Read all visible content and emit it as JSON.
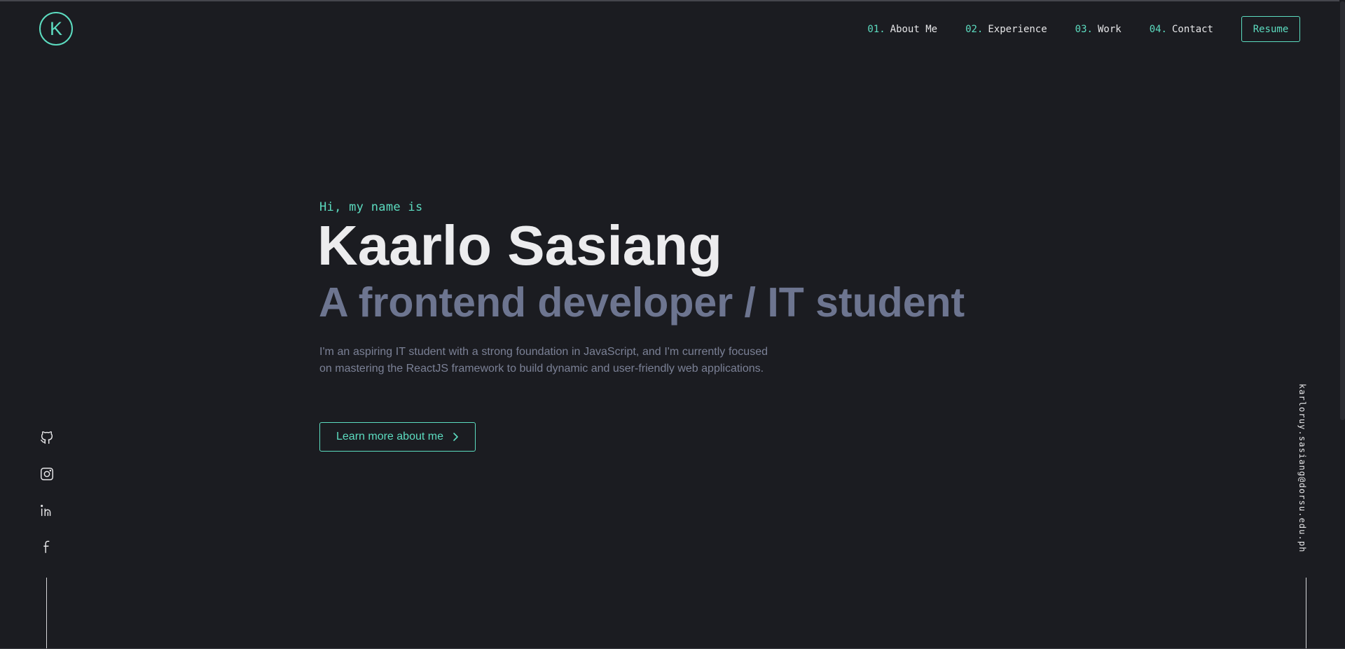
{
  "colors": {
    "background": "#1b1c21",
    "accent": "#5cdcc0",
    "heading": "#ececee",
    "tagline": "#6d7590",
    "body_text": "#7b8196"
  },
  "header": {
    "logo_letter": "K",
    "nav": [
      {
        "number": "01.",
        "label": "About Me"
      },
      {
        "number": "02.",
        "label": "Experience"
      },
      {
        "number": "03.",
        "label": "Work"
      },
      {
        "number": "04.",
        "label": "Contact"
      }
    ],
    "resume_label": "Resume"
  },
  "hero": {
    "greeting": "Hi, my name is",
    "name": "Kaarlo Sasiang",
    "tagline": "A frontend developer / IT student",
    "description": "I'm an aspiring IT student with a strong foundation in JavaScript, and I'm currently focused on mastering the ReactJS framework to build dynamic and user-friendly web applications.",
    "cta_label": "Learn more about me"
  },
  "social": [
    {
      "name": "github",
      "icon": "github-icon"
    },
    {
      "name": "instagram",
      "icon": "instagram-icon"
    },
    {
      "name": "linkedin",
      "icon": "linkedin-icon"
    },
    {
      "name": "facebook",
      "icon": "facebook-icon"
    }
  ],
  "email": "karloruy.sasiang@dorsu.edu.ph"
}
